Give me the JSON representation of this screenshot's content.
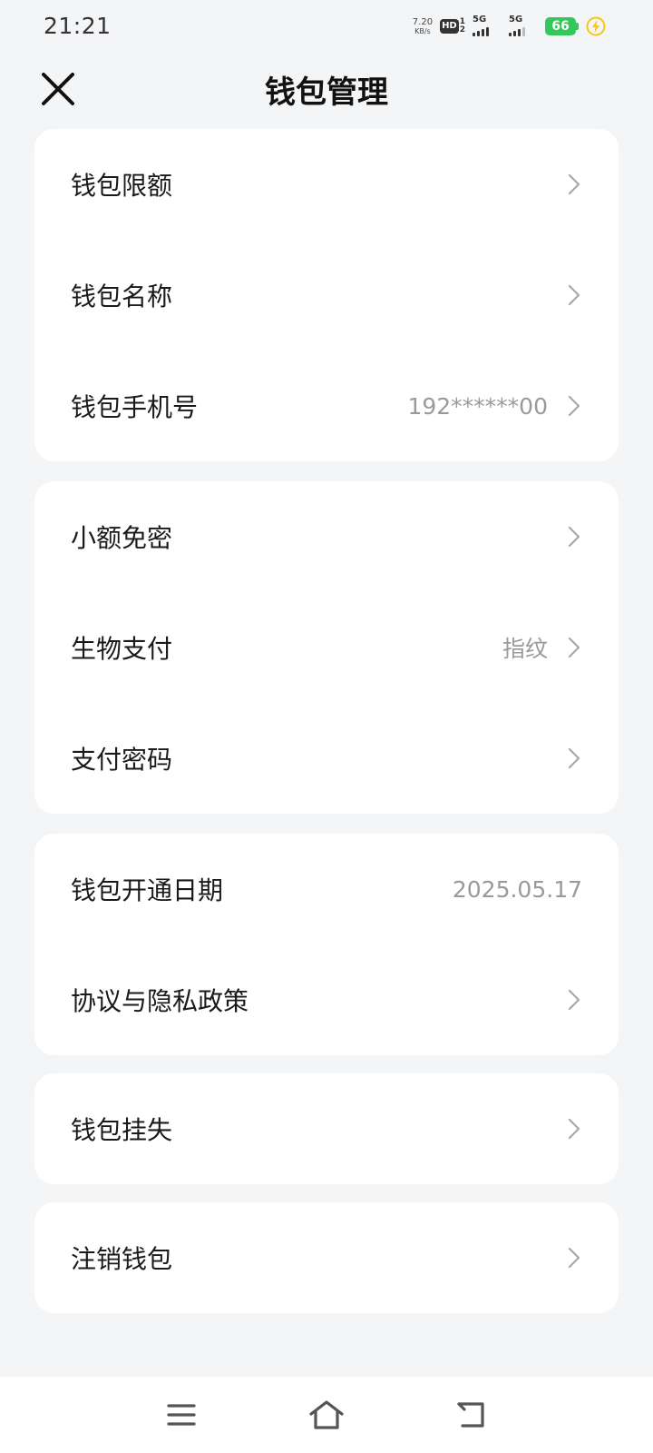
{
  "status_bar": {
    "time": "21:21",
    "net_speed_value": "7.20",
    "net_speed_unit": "KB/s",
    "hd_label": "HD",
    "hd_sim1": "1",
    "hd_sim2": "2",
    "signal1_label": "5G",
    "signal2_label": "5G",
    "battery_level": "66",
    "battery_color": "#34c759"
  },
  "header": {
    "title": "钱包管理",
    "close_icon": "close-icon"
  },
  "groups": [
    {
      "rows": [
        {
          "label": "钱包限额",
          "value": ""
        },
        {
          "label": "钱包名称",
          "value": ""
        },
        {
          "label": "钱包手机号",
          "value": "192******00"
        }
      ]
    },
    {
      "rows": [
        {
          "label": "小额免密",
          "value": ""
        },
        {
          "label": "生物支付",
          "value": "指纹"
        },
        {
          "label": "支付密码",
          "value": ""
        }
      ]
    },
    {
      "rows": [
        {
          "label": "钱包开通日期",
          "value": "2025.05.17"
        },
        {
          "label": "协议与隐私政策",
          "value": ""
        }
      ]
    },
    {
      "rows": [
        {
          "label": "钱包挂失",
          "value": ""
        }
      ]
    },
    {
      "rows": [
        {
          "label": "注销钱包",
          "value": ""
        }
      ]
    }
  ],
  "nav_bar": {
    "icons": [
      "menu-icon",
      "home-icon",
      "back-icon"
    ]
  }
}
